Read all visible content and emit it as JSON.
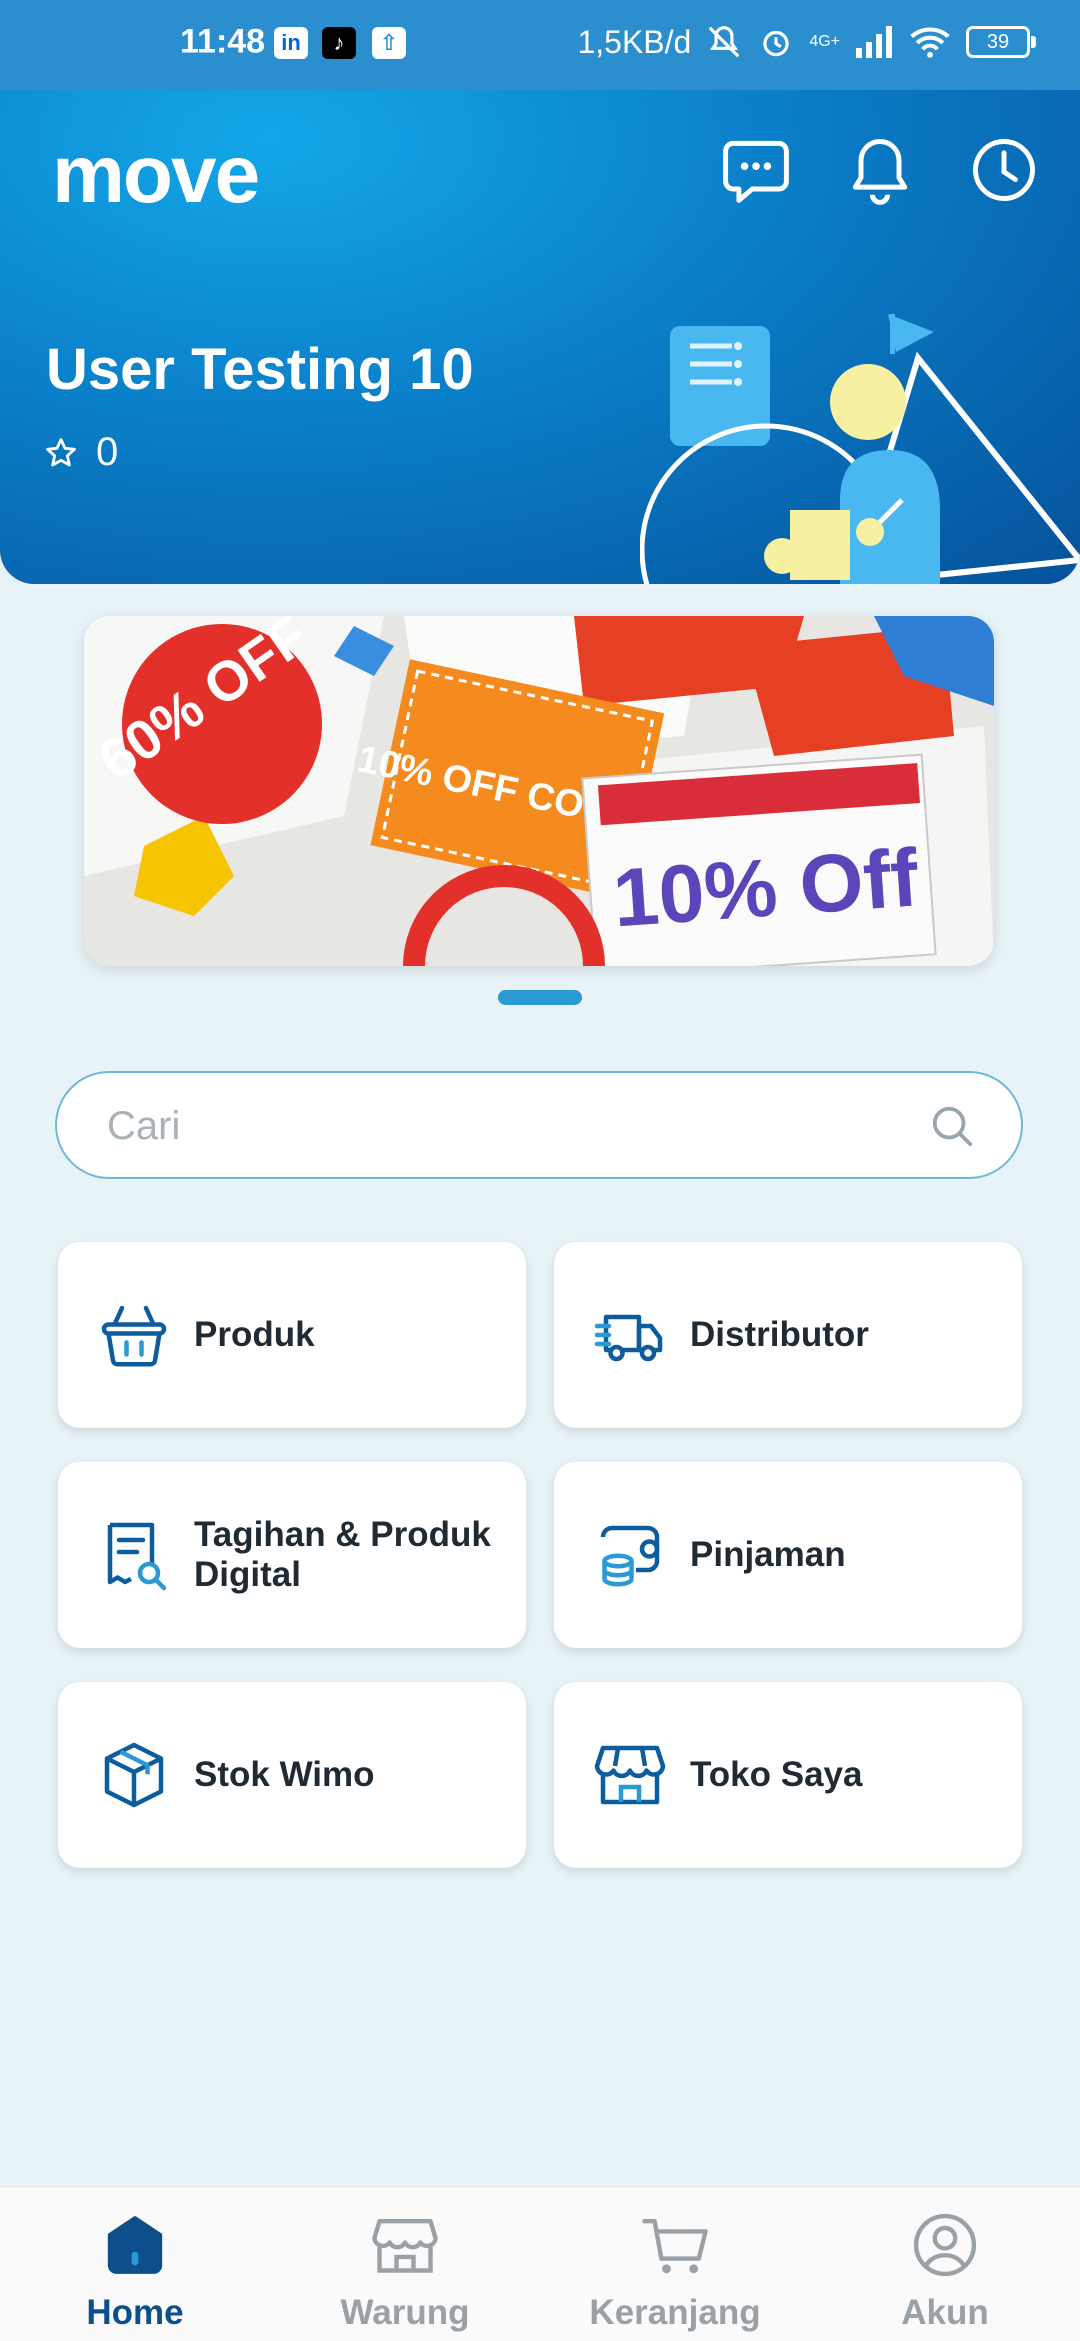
{
  "status_bar": {
    "time": "11:48",
    "speed": "1,5KB/d",
    "network": "4G+",
    "battery": "39"
  },
  "header": {
    "logo": "move",
    "user_name": "User Testing 10",
    "points": "0",
    "icons": [
      "chat-icon",
      "bell-icon",
      "clock-icon"
    ]
  },
  "banner": {
    "promo_1": "60% OFF",
    "promo_2": "10% OFF COUPON",
    "promo_3": "10% Off"
  },
  "search": {
    "placeholder": "Cari"
  },
  "menu": [
    {
      "label": "Produk",
      "icon": "basket-icon"
    },
    {
      "label": "Distributor",
      "icon": "truck-icon"
    },
    {
      "label": "Tagihan & Produk Digital",
      "icon": "receipt-search-icon"
    },
    {
      "label": "Pinjaman",
      "icon": "loan-icon"
    },
    {
      "label": "Stok Wimo",
      "icon": "box-icon"
    },
    {
      "label": "Toko Saya",
      "icon": "store-icon"
    }
  ],
  "bottom_nav": [
    {
      "label": "Home",
      "icon": "home-icon",
      "active": true
    },
    {
      "label": "Warung",
      "icon": "warung-icon",
      "active": false
    },
    {
      "label": "Keranjang",
      "icon": "cart-icon",
      "active": false
    },
    {
      "label": "Akun",
      "icon": "account-icon",
      "active": false
    }
  ],
  "colors": {
    "header": "#0a7ec8",
    "accent": "#2a9ad6",
    "active_nav": "#0d4f8a",
    "background": "#e7f3f7"
  }
}
